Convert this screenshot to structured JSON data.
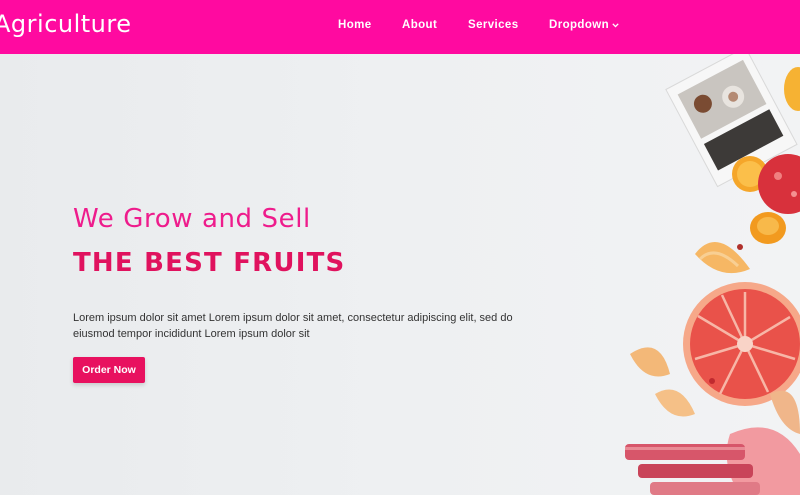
{
  "brand": {
    "name": "Agriculture"
  },
  "nav": {
    "items": [
      {
        "label": "Home"
      },
      {
        "label": "About"
      },
      {
        "label": "Services"
      },
      {
        "label": "Dropdown"
      }
    ]
  },
  "hero": {
    "tagline": "We Grow and Sell",
    "headline": "THE BEST FRUITS",
    "description": "Lorem ipsum dolor sit amet Lorem ipsum dolor sit amet, consectetur adipiscing elit, sed do eiusmod tempor incididunt Lorem ipsum dolor sit",
    "cta_label": "Order Now"
  },
  "colors": {
    "navbar": "#ff0aa0",
    "tagline": "#ee1c8c",
    "headline": "#e0125e",
    "button": "#e8115f"
  },
  "icons": {
    "dropdown": "chevron-down-icon"
  }
}
